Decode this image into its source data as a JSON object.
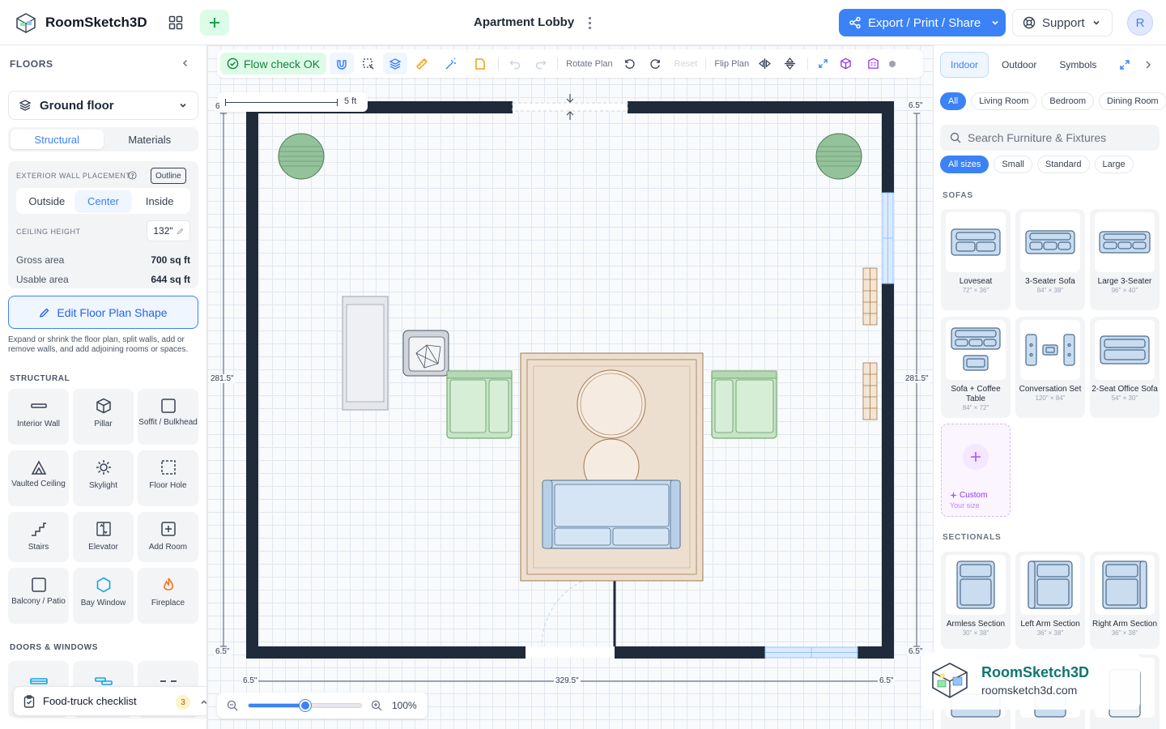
{
  "app": {
    "name": "RoomSketch3D",
    "document_title": "Apartment Lobby",
    "export_label": "Export / Print / Share",
    "support_label": "Support",
    "avatar_initial": "R"
  },
  "left": {
    "floors_label": "FLOORS",
    "floor_selected": "Ground floor",
    "tabs": [
      "Structural",
      "Materials"
    ],
    "wall_placement_label": "EXTERIOR WALL PLACEMENT",
    "outline_label": "Outline",
    "wall_options": [
      "Outside",
      "Center",
      "Inside"
    ],
    "ceiling_label": "CEILING HEIGHT",
    "ceiling_value": "132\"",
    "gross_label": "Gross area",
    "gross_value": "700 sq ft",
    "usable_label": "Usable area",
    "usable_value": "644 sq ft",
    "edit_button": "Edit Floor Plan Shape",
    "help_text": "Expand or shrink the floor plan, split walls, add or remove walls, and add adjoining rooms or spaces.",
    "structural_label": "STRUCTURAL",
    "tools": [
      {
        "label": "Interior Wall",
        "icon": "interior-wall-icon"
      },
      {
        "label": "Pillar",
        "icon": "pillar-icon"
      },
      {
        "label": "Soffit / Bulkhead",
        "icon": "soffit-icon"
      },
      {
        "label": "Vaulted Ceiling",
        "icon": "vaulted-ceiling-icon"
      },
      {
        "label": "Skylight",
        "icon": "skylight-icon"
      },
      {
        "label": "Floor Hole",
        "icon": "floor-hole-icon"
      },
      {
        "label": "Stairs",
        "icon": "stairs-icon"
      },
      {
        "label": "Elevator",
        "icon": "elevator-icon"
      },
      {
        "label": "Add Room",
        "icon": "add-room-icon"
      },
      {
        "label": "Balcony / Patio",
        "icon": "balcony-icon"
      },
      {
        "label": "Bay Window",
        "icon": "bay-window-icon"
      },
      {
        "label": "Fireplace",
        "icon": "fireplace-icon"
      }
    ],
    "doors_label": "DOORS & WINDOWS",
    "checklist_label": "Food-truck checklist",
    "checklist_count": "3"
  },
  "canvas": {
    "flow_label": "Flow check OK",
    "rotate_label": "Rotate Plan",
    "reset_label": "Reset",
    "flip_label": "Flip Plan",
    "scale_label": "5 ft",
    "dims": {
      "top_left": "6",
      "top_right": "6.5\"",
      "left_height": "281.5\"",
      "right_height": "281.5\"",
      "bottom_left_corner": "6.5\"",
      "bottom_right_corner": "6.5\"",
      "bottom_left": "6.5\"",
      "bottom_width": "329.5\"",
      "bottom_right": "6.5\""
    },
    "zoom_percent": "100%",
    "zoom_level": 0.5
  },
  "right": {
    "tabs": [
      "Indoor",
      "Outdoor",
      "Symbols"
    ],
    "rooms": [
      "All",
      "Living Room",
      "Bedroom",
      "Dining Room"
    ],
    "search_placeholder": "Search Furniture & Fixtures",
    "sizes": [
      "All sizes",
      "Small",
      "Standard",
      "Large"
    ],
    "sofas_label": "SOFAS",
    "sofas": [
      {
        "name": "Loveseat",
        "size": "72\" × 36\""
      },
      {
        "name": "3-Seater Sofa",
        "size": "84\" × 38\""
      },
      {
        "name": "Large 3-Seater",
        "size": "96\" × 40\""
      },
      {
        "name": "Sofa + Coffee Table",
        "size": "84\" × 72\""
      },
      {
        "name": "Conversation Set",
        "size": "120\" × 84\""
      },
      {
        "name": "2-Seat Office Sofa",
        "size": "54\" × 30\""
      }
    ],
    "custom_label": "Custom",
    "custom_sub": "Your size",
    "sectionals_label": "SECTIONALS",
    "sectionals": [
      {
        "name": "Armless Section",
        "size": "30\" × 38\""
      },
      {
        "name": "Left Arm Section",
        "size": "36\" × 38\""
      },
      {
        "name": "Right Arm Section",
        "size": "36\" × 38\""
      }
    ]
  },
  "watermark": {
    "name": "RoomSketch3D",
    "url": "roomsketch3d.com"
  }
}
